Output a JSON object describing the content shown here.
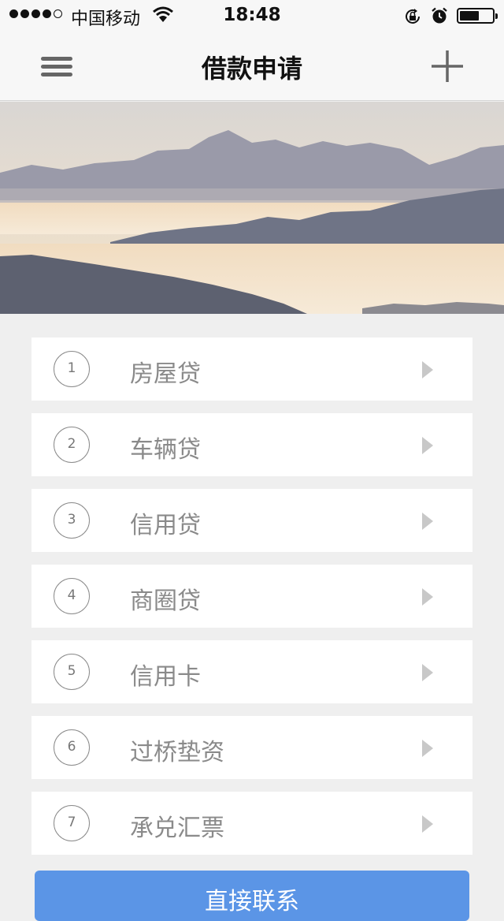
{
  "status_bar": {
    "carrier": "中国移动",
    "time": "18:48"
  },
  "nav": {
    "title": "借款申请",
    "menu_icon": "hamburger-menu-icon",
    "add_icon": "plus-icon"
  },
  "banner": {
    "subject": "mountain landscape photo",
    "colors": {
      "sky": "#e6ddd2",
      "far_ridge": "#9797a6",
      "near_ridge": "#6e7385",
      "haze": "#f1e1c8"
    }
  },
  "loan_types": [
    {
      "number": "1",
      "label": "房屋贷"
    },
    {
      "number": "2",
      "label": "车辆贷"
    },
    {
      "number": "3",
      "label": "信用贷"
    },
    {
      "number": "4",
      "label": "商圈贷"
    },
    {
      "number": "5",
      "label": "信用卡"
    },
    {
      "number": "6",
      "label": "过桥垫资"
    },
    {
      "number": "7",
      "label": "承兑汇票"
    }
  ],
  "contact_button": {
    "label": "直接联系"
  },
  "colors": {
    "accent": "#5b95e6",
    "background": "#efefef",
    "item_text": "#8a8a8a",
    "arrow": "#c8c8c8"
  }
}
